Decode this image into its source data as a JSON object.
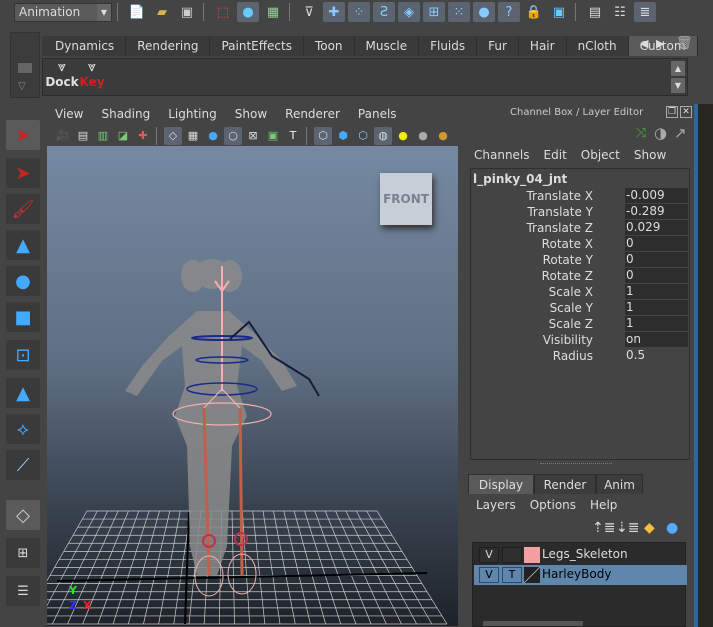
{
  "toolbar": {
    "mode": "Animation"
  },
  "shelf": {
    "tabs": [
      "Dynamics",
      "Rendering",
      "PaintEffects",
      "Toon",
      "Muscle",
      "Fluids",
      "Fur",
      "Hair",
      "nCloth",
      "Custom"
    ],
    "active_tab": "Custom",
    "items": [
      {
        "label": "Dock",
        "color": "#e0e0e0"
      },
      {
        "label": "Key",
        "color": "#d02020"
      }
    ]
  },
  "viewport": {
    "menu": [
      "View",
      "Shading",
      "Lighting",
      "Show",
      "Renderer",
      "Panels"
    ],
    "view_cube": "FRONT",
    "axis": {
      "y": "Y",
      "z": "Z",
      "x": "X"
    }
  },
  "channel_box": {
    "title": "Channel Box / Layer Editor",
    "menu": [
      "Channels",
      "Edit",
      "Object",
      "Show"
    ],
    "object": "l_pinky_04_jnt",
    "channels": [
      {
        "label": "Translate X",
        "value": "-0.009"
      },
      {
        "label": "Translate Y",
        "value": "-0.289"
      },
      {
        "label": "Translate Z",
        "value": "0.029"
      },
      {
        "label": "Rotate X",
        "value": "0"
      },
      {
        "label": "Rotate Y",
        "value": "0"
      },
      {
        "label": "Rotate Z",
        "value": "0"
      },
      {
        "label": "Scale X",
        "value": "1"
      },
      {
        "label": "Scale Y",
        "value": "1"
      },
      {
        "label": "Scale Z",
        "value": "1"
      },
      {
        "label": "Visibility",
        "value": "on"
      }
    ],
    "radius": {
      "label": "Radius",
      "value": "0.5"
    }
  },
  "layer_editor": {
    "tabs": [
      "Display",
      "Render",
      "Anim"
    ],
    "active_tab": "Display",
    "menu": [
      "Layers",
      "Options",
      "Help"
    ],
    "layers": [
      {
        "v": "V",
        "t": "",
        "name": "Legs_Skeleton",
        "color": "#f4a0a0",
        "selected": false
      },
      {
        "v": "V",
        "t": "T",
        "name": "HarleyBody",
        "color": "#222222",
        "selected": true
      }
    ]
  }
}
